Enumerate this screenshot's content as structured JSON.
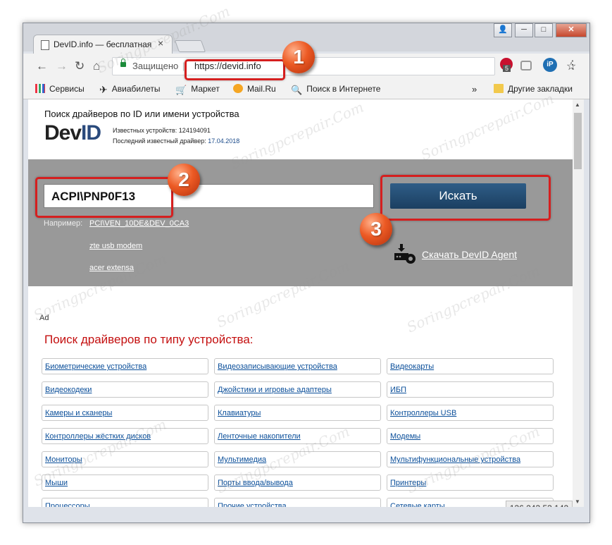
{
  "browser": {
    "tab_title": "DevID.info — бесплатная",
    "tab_close": "×",
    "window_controls": [
      "👤",
      "─",
      "□",
      "✕"
    ],
    "nav": {
      "back": "←",
      "forward": "→",
      "reload": "↻",
      "home": "⌂"
    },
    "security_label": "Защищено",
    "url": "https://devid.info",
    "bookmark_star": "☆",
    "extensions": {
      "abp_count": "5",
      "ip_label": "iP",
      "menu": "⋮"
    },
    "bookmarks": [
      "Сервисы",
      "Авиабилеты",
      "Маркет",
      "Mail.Ru",
      "Поиск в Интернете"
    ],
    "bookmarks_more": "»",
    "other_bookmarks": "Другие закладки"
  },
  "page": {
    "heading": "Поиск драйверов по ID или имени устройства",
    "logo_dev": "Dev",
    "logo_id": "ID",
    "known_devices_label": "Известных устройств: 124194091",
    "last_driver_label": "Последний известный драйвер:",
    "last_driver_date": "17.04.2018",
    "search_value": "ACPI\\PNP0F13",
    "search_button": "Искать",
    "examples_label": "Например:",
    "examples": [
      "PCI\\VEN_10DE&DEV_0CA3",
      "zte usb modem",
      "acer extensa"
    ],
    "agent_link": "Скачать DevID Agent",
    "ad_label": "Ad",
    "categories_heading": "Поиск драйверов по типу устройства:",
    "categories": [
      "Биометрические устройства",
      "Видеозаписывающие устройства",
      "Видеокарты",
      "Видеокодеки",
      "Джойстики и игровые адаптеры",
      "ИБП",
      "Камеры и сканеры",
      "Клавиатуры",
      "Контроллеры USB",
      "Контроллеры жёстких дисков",
      "Ленточные накопители",
      "Модемы",
      "Мониторы",
      "Мультимедиа",
      "Мультифункциональные устройства",
      "Мыши",
      "Порты ввода/вывода",
      "Принтеры",
      "Процессоры",
      "Прочие устройства",
      "Сетевые карты"
    ],
    "ip_address": "136.243.53.142"
  },
  "annotations": {
    "steps": [
      "1",
      "2",
      "3"
    ]
  },
  "watermark": "Soringpcrepair.Com",
  "colors": {
    "accent_red": "#d51f1f",
    "category_heading": "#c40f0f",
    "button_blue": "#1b3f61",
    "panel_gray": "#999999"
  }
}
